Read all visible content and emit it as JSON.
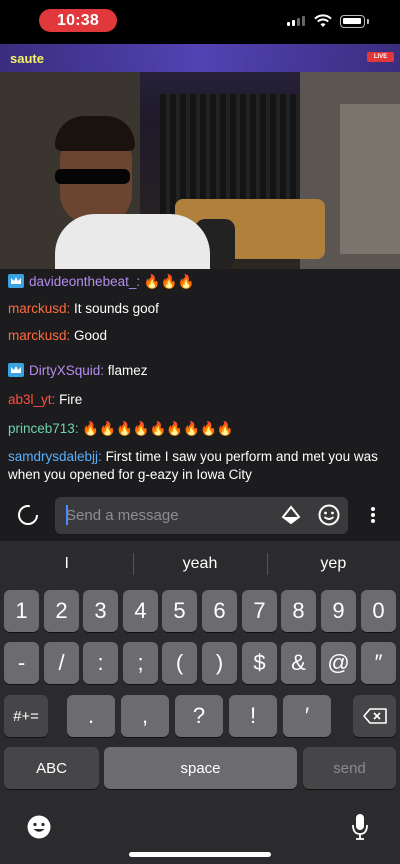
{
  "status_bar": {
    "time": "10:38"
  },
  "video": {
    "logo_text": "saute",
    "live_label": "LIVE"
  },
  "chat": {
    "messages": [
      {
        "user": "davideonthebeat_",
        "text": "🔥🔥🔥",
        "badge": "crown-icon",
        "color": "#b58cf0"
      },
      {
        "user": "marckusd",
        "text": "It sounds goof",
        "color": "#ff6b3d"
      },
      {
        "user": "marckusd",
        "text": "Good",
        "color": "#ff6b3d"
      },
      {
        "user": "DirtyXSquid",
        "text": "flamez",
        "badge": "crown-icon",
        "color": "#b58cf0"
      },
      {
        "user": "ab3l_yt",
        "text": "Fire",
        "color": "#ff5040"
      },
      {
        "user": "princeb713",
        "text": "🔥🔥🔥🔥🔥🔥🔥🔥🔥",
        "color": "#6fd1b0"
      },
      {
        "user": "samdrysdalebjj",
        "text": "First time I saw you perform and met you was when you opened for  g-eazy in Iowa City",
        "color": "#5ab0ff"
      }
    ]
  },
  "input": {
    "placeholder": "Send a message"
  },
  "keyboard": {
    "suggestions": [
      "I",
      "yeah",
      "yep"
    ],
    "row1": [
      "1",
      "2",
      "3",
      "4",
      "5",
      "6",
      "7",
      "8",
      "9",
      "0"
    ],
    "row2": [
      "-",
      "/",
      ":",
      ";",
      "(",
      ")",
      "$",
      "&",
      "@",
      "″"
    ],
    "row3": [
      ".",
      ",",
      "?",
      "!",
      "′"
    ],
    "mode_symbols": "#+=",
    "mode_abc": "ABC",
    "space_label": "space",
    "send_label": "send"
  },
  "colors": {
    "live_red": "#e0383b",
    "accent_blue": "#4a8cff",
    "chat_bg": "#1c1c1e"
  }
}
